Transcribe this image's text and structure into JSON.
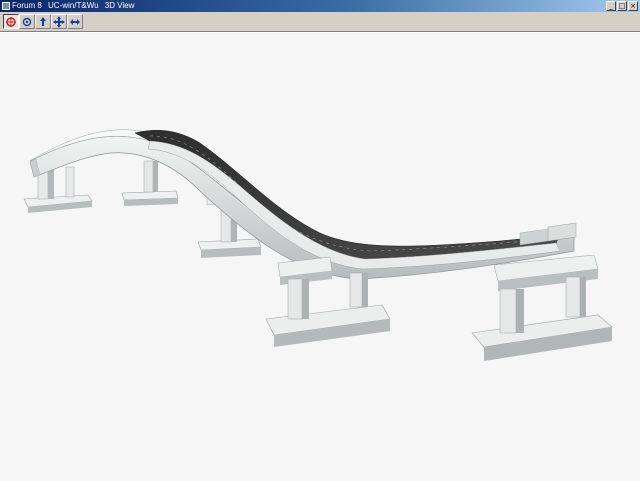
{
  "window": {
    "title_parts": [
      "Forum 8",
      "UC-win/T&Wu",
      "3D View"
    ],
    "controls": {
      "minimize": "_",
      "maximize": "□",
      "close": "×"
    }
  },
  "toolbar": {
    "tools": [
      {
        "icon": "rotate-icon",
        "active": true
      },
      {
        "icon": "orbit-icon",
        "active": false
      },
      {
        "icon": "tilt-icon",
        "active": false
      },
      {
        "icon": "pan-icon",
        "active": false
      },
      {
        "icon": "zoom-icon",
        "active": false
      }
    ]
  },
  "viewport": {
    "background": "#f6f6f6",
    "scene": "curved elevated bridge on piers"
  },
  "colors": {
    "title_start": "#0a246a",
    "title_end": "#a6caf0",
    "deck_surface": "#3a3a3a",
    "concrete": "#e4e6e6",
    "concrete_shadow": "#a9acad"
  }
}
